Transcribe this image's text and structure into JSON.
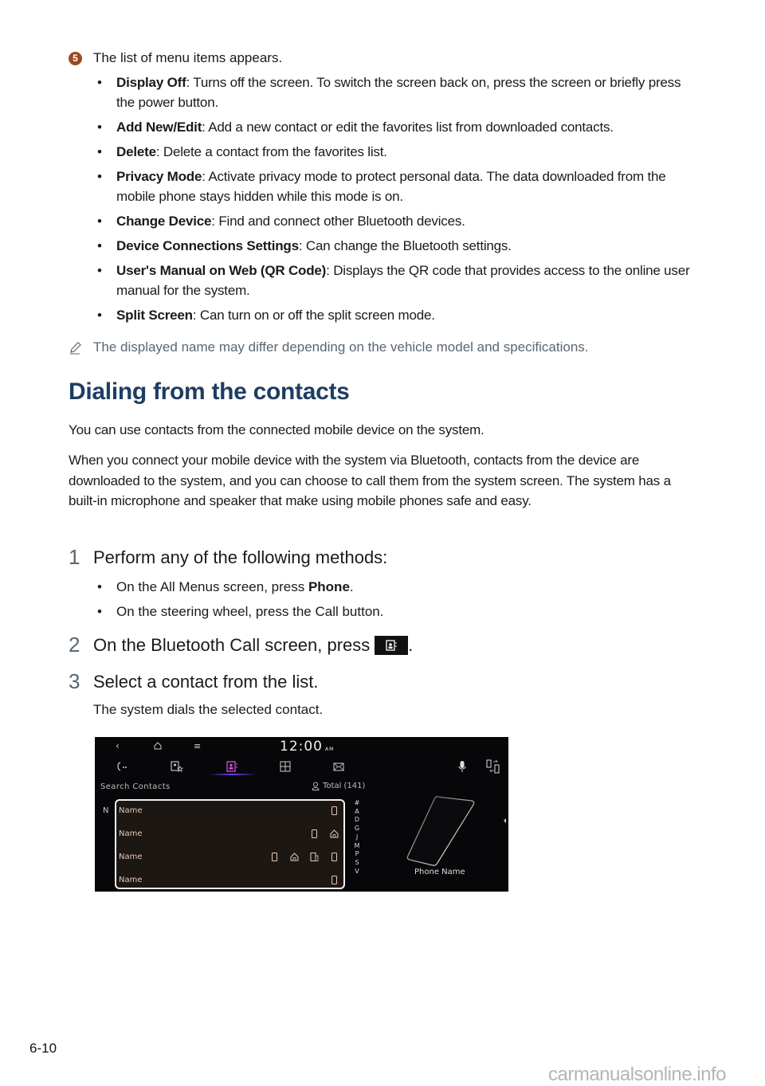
{
  "step5": {
    "badge": "5",
    "text": "The list of menu items appears.",
    "items": [
      {
        "term": "Display Off",
        "desc": ": Turns off the screen. To switch the screen back on, press the screen or briefly press the power button."
      },
      {
        "term": "Add New/Edit",
        "desc": ": Add a new contact or edit the favorites list from downloaded contacts."
      },
      {
        "term": "Delete",
        "desc": ": Delete a contact from the favorites list."
      },
      {
        "term": "Privacy Mode",
        "desc": ": Activate privacy mode to protect personal data. The data downloaded from the mobile phone stays hidden while this mode is on."
      },
      {
        "term": "Change Device",
        "desc": ": Find and connect other Bluetooth devices."
      },
      {
        "term": "Device Connections Settings",
        "desc": ": Can change the Bluetooth settings."
      },
      {
        "term": "User's Manual on Web (QR Code)",
        "desc": ": Displays the QR code that provides access to the online user manual for the system."
      },
      {
        "term": "Split Screen",
        "desc": ": Can turn on or off the split screen mode."
      }
    ]
  },
  "note": {
    "icon": "pencil-icon",
    "text": "The displayed name may differ depending on the vehicle model and specifications."
  },
  "section": {
    "title": "Dialing from the contacts",
    "para1": "You can use contacts from the connected mobile device on the system.",
    "para2": "When you connect your mobile device with the system via Bluetooth, contacts from the device are downloaded to the system, and you can choose to call them from the system screen. The system has a built-in microphone and speaker that make using mobile phones safe and easy."
  },
  "steps": [
    {
      "num": "1",
      "text": "Perform any of the following methods:",
      "bullets": [
        {
          "pre": "On the All Menus screen, press ",
          "bold": "Phone",
          "post": "."
        },
        {
          "pre": "On the steering wheel, press the Call button.",
          "bold": "",
          "post": ""
        }
      ]
    },
    {
      "num": "2",
      "text": "On the Bluetooth Call screen, press",
      "post": "."
    },
    {
      "num": "3",
      "text": "Select a contact from the list.",
      "result": "The system dials the selected contact."
    }
  ],
  "screen": {
    "clock": "12:00",
    "ampm": "AM",
    "search_label": "Search Contacts",
    "total": "Total (141)",
    "index_letter": "N",
    "contacts": [
      {
        "name": "Name",
        "icons": [
          "mobile"
        ]
      },
      {
        "name": "Name",
        "icons": [
          "mobile",
          "home"
        ]
      },
      {
        "name": "Name",
        "icons": [
          "mobile",
          "home",
          "office",
          "mobile"
        ]
      },
      {
        "name": "Name",
        "icons": [
          "mobile"
        ]
      }
    ],
    "alphabet": [
      "#",
      "A",
      "D",
      "G",
      "J",
      "M",
      "P",
      "S",
      "V"
    ],
    "phone_name": "Phone Name",
    "accent_color": "#7a3cff",
    "active_tab": "contacts"
  },
  "footer": {
    "page_number": "6-10",
    "watermark": "carmanualsonline.info"
  }
}
